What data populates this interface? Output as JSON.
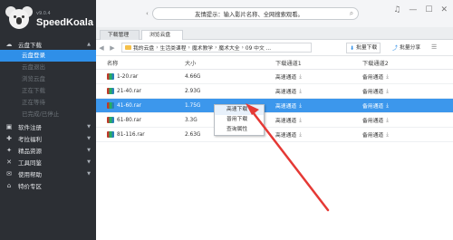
{
  "app": {
    "version": "v9.0.4",
    "name": "SpeedKoala"
  },
  "sidebar": {
    "sections": [
      {
        "label": "云盘下载",
        "icon": "cloud-icon"
      },
      {
        "label": "软件注册",
        "icon": "register-icon"
      },
      {
        "label": "考拉福利",
        "icon": "gift-icon"
      },
      {
        "label": "精品资源",
        "icon": "star-icon"
      },
      {
        "label": "工具同鉴",
        "icon": "tools-icon"
      },
      {
        "label": "使用帮助",
        "icon": "help-icon"
      },
      {
        "label": "特价专区",
        "icon": "tag-icon"
      }
    ],
    "sub_items": [
      "云盘登录",
      "云盘退出",
      "浏览云盘",
      "正在下载",
      "正在等待",
      "已完成/已停止"
    ]
  },
  "topbar": {
    "search_placeholder": "友情提示：输入影片名称、全网搜索观看。"
  },
  "tabs": [
    "下载管理",
    "浏览云盘"
  ],
  "breadcrumb": {
    "parts": [
      "我的云盘",
      "生活类课程",
      "魔术教学",
      "魔术大全",
      "09 中文 ..."
    ],
    "batch_download": "批量下载",
    "batch_share": "批量分享"
  },
  "table": {
    "headers": [
      "名称",
      "大小",
      "下载通道1",
      "下载通道2"
    ],
    "rows": [
      {
        "name": "1-20.rar",
        "size": "4.66G",
        "ch1": "高速通道",
        "ch2": "备用通道"
      },
      {
        "name": "21-40.rar",
        "size": "2.93G",
        "ch1": "高速通道",
        "ch2": "备用通道"
      },
      {
        "name": "41-60.rar",
        "size": "1.75G",
        "ch1": "高速通道",
        "ch2": "备用通道"
      },
      {
        "name": "61-80.rar",
        "size": "3.3G",
        "ch1": "高速通道",
        "ch2": "备用通道"
      },
      {
        "name": "81-116.rar",
        "size": "2.63G",
        "ch1": "高速通道",
        "ch2": "备用通道"
      }
    ]
  },
  "context_menu": [
    "高速下载",
    "普用下载",
    "查询属性"
  ],
  "colors": {
    "sidebar_bg": "#2c2f34",
    "accent": "#2f8fe8",
    "arrow": "#e53935"
  }
}
